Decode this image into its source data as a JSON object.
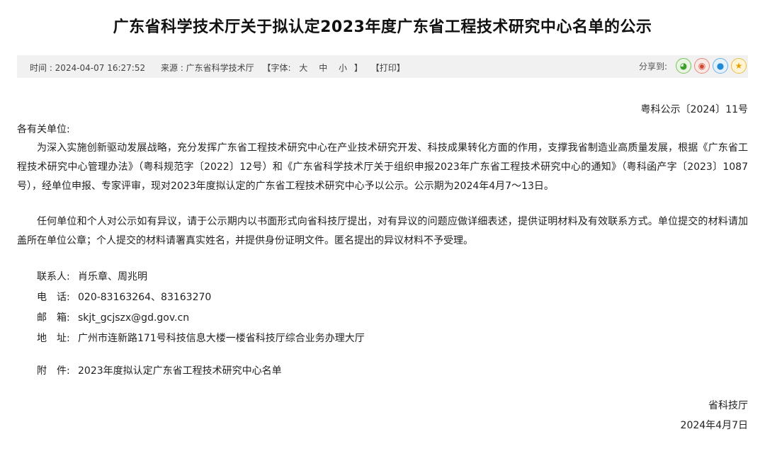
{
  "title": "广东省科学技术厅关于拟认定2023年度广东省工程技术研究中心名单的公示",
  "meta": {
    "time": "时间 : 2024-04-07 16:27:52",
    "source": "来源 : 广东省科学技术厅",
    "font_open": "【字体:",
    "font_large": "大",
    "font_medium": "中",
    "font_small": "小",
    "font_close": "】",
    "print": "【打印】"
  },
  "share": {
    "label": "分享到:",
    "buttons": [
      {
        "icon": "wechat-icon",
        "glyph": "◕",
        "color": "#3c9d2b"
      },
      {
        "icon": "weibo-icon",
        "glyph": "◉",
        "color": "#d6452f"
      },
      {
        "icon": "qq-icon",
        "glyph": "●",
        "color": "#1f8ad6"
      },
      {
        "icon": "qzone-icon",
        "glyph": "★",
        "color": "#e3a300"
      }
    ]
  },
  "doc": {
    "number": "粤科公示〔2024〕11号",
    "greeting": "各有关单位:",
    "paragraphs": [
      "为深入实施创新驱动发展战略，充分发挥广东省工程技术研究中心在产业技术研究开发、科技成果转化方面的作用，支撑我省制造业高质量发展，根据《广东省工程技术研究中心管理办法》（粤科规范字〔2022〕12号）和《广东省科学技术厅关于组织申报2023年广东省工程技术研究中心的通知》（粤科函产字〔2023〕1087号），经单位申报、专家评审，现对2023年度拟认定的广东省工程技术研究中心予以公示。公示期为2024年4月7～13日。",
      "任何单位和个人对公示如有异议，请于公示期内以书面形式向省科技厅提出，对有异议的问题应做详细表述，提供证明材料及有效联系方式。单位提交的材料请加盖所在单位公章；个人提交的材料请署真实姓名，并提供身份证明文件。匿名提出的异议材料不予受理。"
    ],
    "contacts": [
      {
        "label": "联系人:",
        "value": "肖乐章、周兆明"
      },
      {
        "label": "电　话:",
        "value": "020-83163264、83163270"
      },
      {
        "label": "邮　箱:",
        "value": "skjt_gcjszx@gd.gov.cn"
      },
      {
        "label": "地　址:",
        "value": "广州市连新路171号科技信息大楼一楼省科技厅综合业务办理大厅"
      }
    ],
    "attachment": {
      "label": "附　件:",
      "value": "2023年度拟认定广东省工程技术研究中心名单"
    },
    "signature": "省科技厅",
    "date": "2024年4月7日"
  }
}
